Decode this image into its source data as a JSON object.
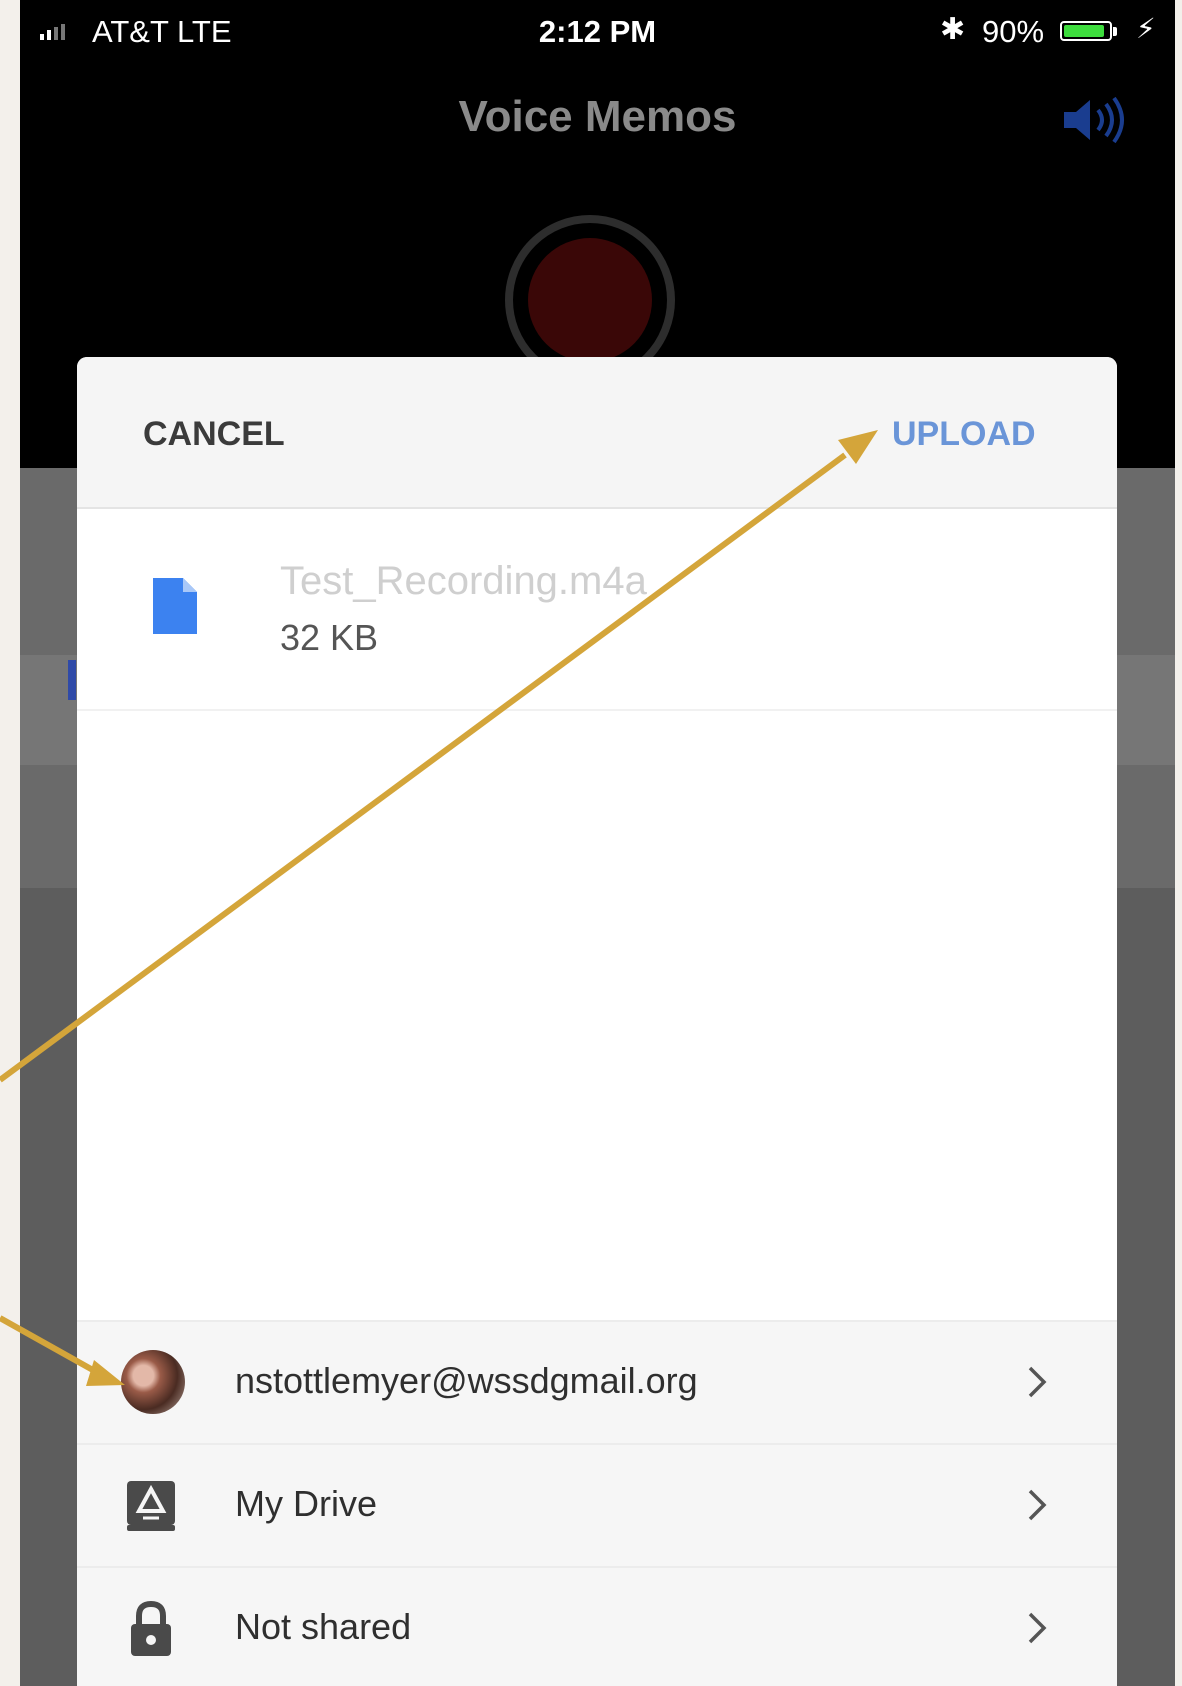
{
  "status_bar": {
    "carrier": "AT&T  LTE",
    "time": "2:12 PM",
    "battery": "90%",
    "battery_level": 0.9
  },
  "app": {
    "title": "Voice Memos"
  },
  "sheet": {
    "cancel_label": "CANCEL",
    "upload_label": "UPLOAD",
    "file": {
      "name": "Test_Recording.m4a",
      "size": "32 KB"
    },
    "options": {
      "account": "nstottlemyer@wssdgmail.org",
      "folder": "My Drive",
      "sharing": "Not shared"
    }
  },
  "colors": {
    "accent": "#6a95d8",
    "file_icon": "#3c82f0",
    "annotation_arrow": "#d4a53a"
  },
  "icons": {
    "file": "document-icon",
    "folder": "drive-icon",
    "sharing": "lock-icon"
  }
}
